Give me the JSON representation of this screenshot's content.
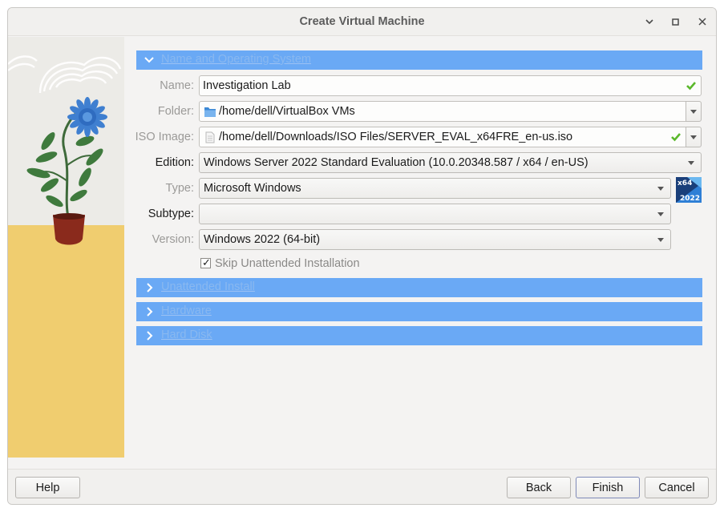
{
  "window": {
    "title": "Create Virtual Machine",
    "controls": {
      "minimize": "▾",
      "maximize": "▫",
      "close": "✕"
    }
  },
  "sections": {
    "name_os": "Name and Operating System",
    "unattended": "Unattended Install",
    "hardware": "Hardware",
    "hard_disk": "Hard Disk"
  },
  "form": {
    "name": {
      "label": "Name:",
      "value": "Investigation Lab"
    },
    "folder": {
      "label": "Folder:",
      "value": "/home/dell/VirtualBox VMs"
    },
    "iso": {
      "label": "ISO Image:",
      "value": "/home/dell/Downloads/ISO Files/SERVER_EVAL_x64FRE_en-us.iso"
    },
    "edition": {
      "label": "Edition:",
      "value": "Windows Server 2022 Standard Evaluation (10.0.20348.587 / x64 / en-US)"
    },
    "type": {
      "label": "Type:",
      "value": "Microsoft Windows"
    },
    "subtype": {
      "label": "Subtype:",
      "value": ""
    },
    "version": {
      "label": "Version:",
      "value": "Windows 2022 (64-bit)"
    },
    "skip_unattended": {
      "label": "Skip Unattended Installation",
      "checked": true,
      "mark": "✓"
    }
  },
  "os_badge": {
    "line1": "x64",
    "line2": "2022"
  },
  "buttons": {
    "help": "Help",
    "back": "Back",
    "finish": "Finish",
    "cancel": "Cancel"
  },
  "colors": {
    "section_header": "#6aa9f5",
    "valid_check": "#5ab82a",
    "side_yellow": "#f0cd6f"
  }
}
